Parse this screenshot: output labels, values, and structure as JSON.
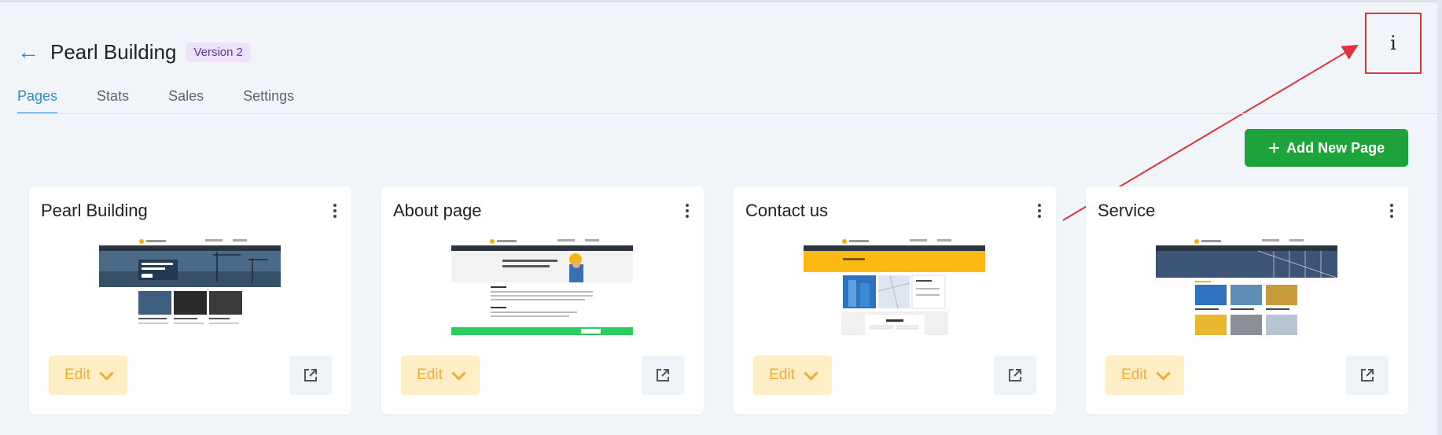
{
  "header": {
    "back_icon": "arrow-left-icon",
    "title": "Pearl Building",
    "version": "Version 2",
    "info_label": "i"
  },
  "tabs": [
    {
      "label": "Pages",
      "active": true
    },
    {
      "label": "Stats",
      "active": false
    },
    {
      "label": "Sales",
      "active": false
    },
    {
      "label": "Settings",
      "active": false
    }
  ],
  "toolbar": {
    "add_page_label": "Add New Page",
    "add_icon": "plus-icon"
  },
  "cards": [
    {
      "title": "Pearl Building",
      "edit_label": "Edit",
      "thumbnail": "home-page-preview"
    },
    {
      "title": "About page",
      "edit_label": "Edit",
      "thumbnail": "about-page-preview"
    },
    {
      "title": "Contact us",
      "edit_label": "Edit",
      "thumbnail": "contact-page-preview"
    },
    {
      "title": "Service",
      "edit_label": "Edit",
      "thumbnail": "service-page-preview"
    }
  ],
  "colors": {
    "accent": "#2b8cd6",
    "primary_button": "#1ea33a",
    "edit_bg": "#fdeec6",
    "edit_text": "#f0ad2c",
    "annotation": "#d9353a",
    "version_bg": "#ece3fb",
    "version_text": "#5b35a8"
  }
}
